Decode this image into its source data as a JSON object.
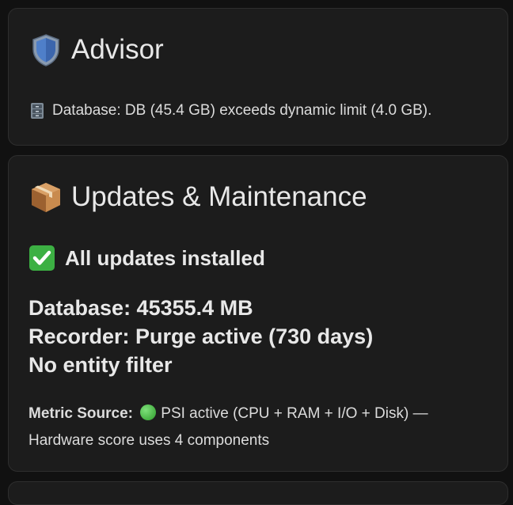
{
  "advisor": {
    "title": "Advisor",
    "icon": "shield-icon",
    "message": "Database: DB (45.4 GB) exceeds dynamic limit (4.0 GB).",
    "message_icon": "file-cabinet-icon"
  },
  "updates": {
    "title": "Updates & Maintenance",
    "icon": "package-icon",
    "status": "All updates installed",
    "status_icon": "check-mark-icon",
    "database": "Database: 45355.4 MB",
    "recorder": "Recorder: Purge active (730 days)",
    "entity_filter": "No entity filter",
    "metric_label": "Metric Source:",
    "metric_icon": "green-circle-icon",
    "metric_text": "PSI active (CPU + RAM + I/O + Disk) — Hardware score uses 4 components"
  },
  "colors": {
    "background": "#111111",
    "card": "#1c1c1c",
    "text": "#e4e4e4",
    "status_green": "#3cb043"
  }
}
